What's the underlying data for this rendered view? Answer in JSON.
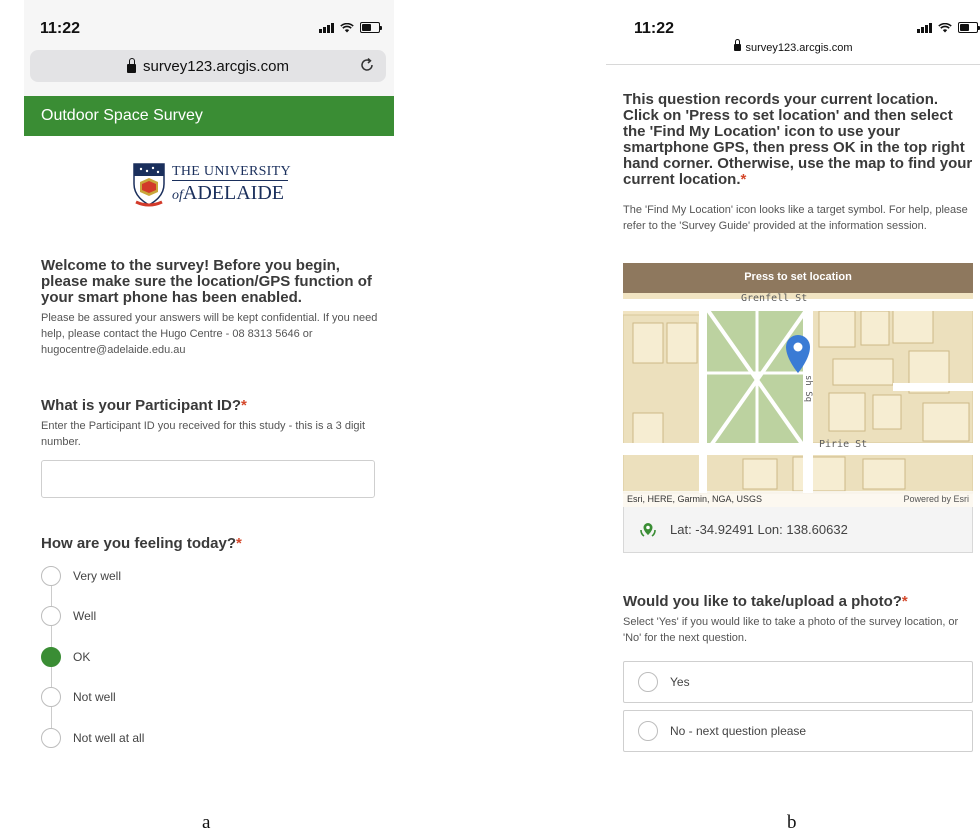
{
  "phone_a": {
    "status": {
      "time": "11:22"
    },
    "url": "survey123.arcgis.com",
    "header_title": "Outdoor Space Survey",
    "logo": {
      "line1": "THE UNIVERSITY",
      "line2": "ADELAIDE",
      "of": "of"
    },
    "welcome": {
      "title": "Welcome to the survey! Before you begin, please make sure the location/GPS function of your smart phone has been enabled.",
      "desc": "Please be assured your answers will be kept confidential. If you need help, please contact the Hugo Centre - 08 8313 5646 or hugocentre@adelaide.edu.au"
    },
    "participant": {
      "title": "What is your Participant ID?",
      "required_mark": "*",
      "desc": "Enter the Participant ID you received for this study - this is a 3 digit number.",
      "value": ""
    },
    "feeling": {
      "title": "How are you feeling today?",
      "required_mark": "*",
      "options": [
        "Very well",
        "Well",
        "OK",
        "Not well",
        "Not well at all"
      ],
      "selected": "OK"
    }
  },
  "phone_b": {
    "status": {
      "time": "11:22"
    },
    "url": "survey123.arcgis.com",
    "location": {
      "title": "This question records your current location. Click on 'Press to set location' and then select the 'Find My Location' icon to use your smartphone GPS, then press OK in the top right hand corner. Otherwise, use the map to find your current location.",
      "required_mark": "*",
      "desc": "The 'Find My Location' icon looks like a target symbol. For help, please refer to the 'Survey Guide' provided at the information session."
    },
    "map": {
      "bar_label": "Press to set location",
      "street_1": "Grenfell St",
      "street_2": "Pirie St",
      "street_3": "sh Sq",
      "attribution": "Esri, HERE, Garmin, NGA, USGS",
      "powered_by": "Powered by Esri"
    },
    "coords": "Lat: -34.92491  Lon: 138.60632",
    "photo": {
      "title": "Would you like to take/upload a photo?",
      "required_mark": "*",
      "desc": "Select 'Yes' if you would like to take a photo of the survey location, or 'No' for the next question.",
      "options": [
        "Yes",
        "No - next question please"
      ]
    }
  },
  "captions": {
    "a": "a",
    "b": "b"
  },
  "colors": {
    "header_green": "#3a8d34",
    "required_red": "#d4482b",
    "pin_blue": "#3a7bd5"
  }
}
